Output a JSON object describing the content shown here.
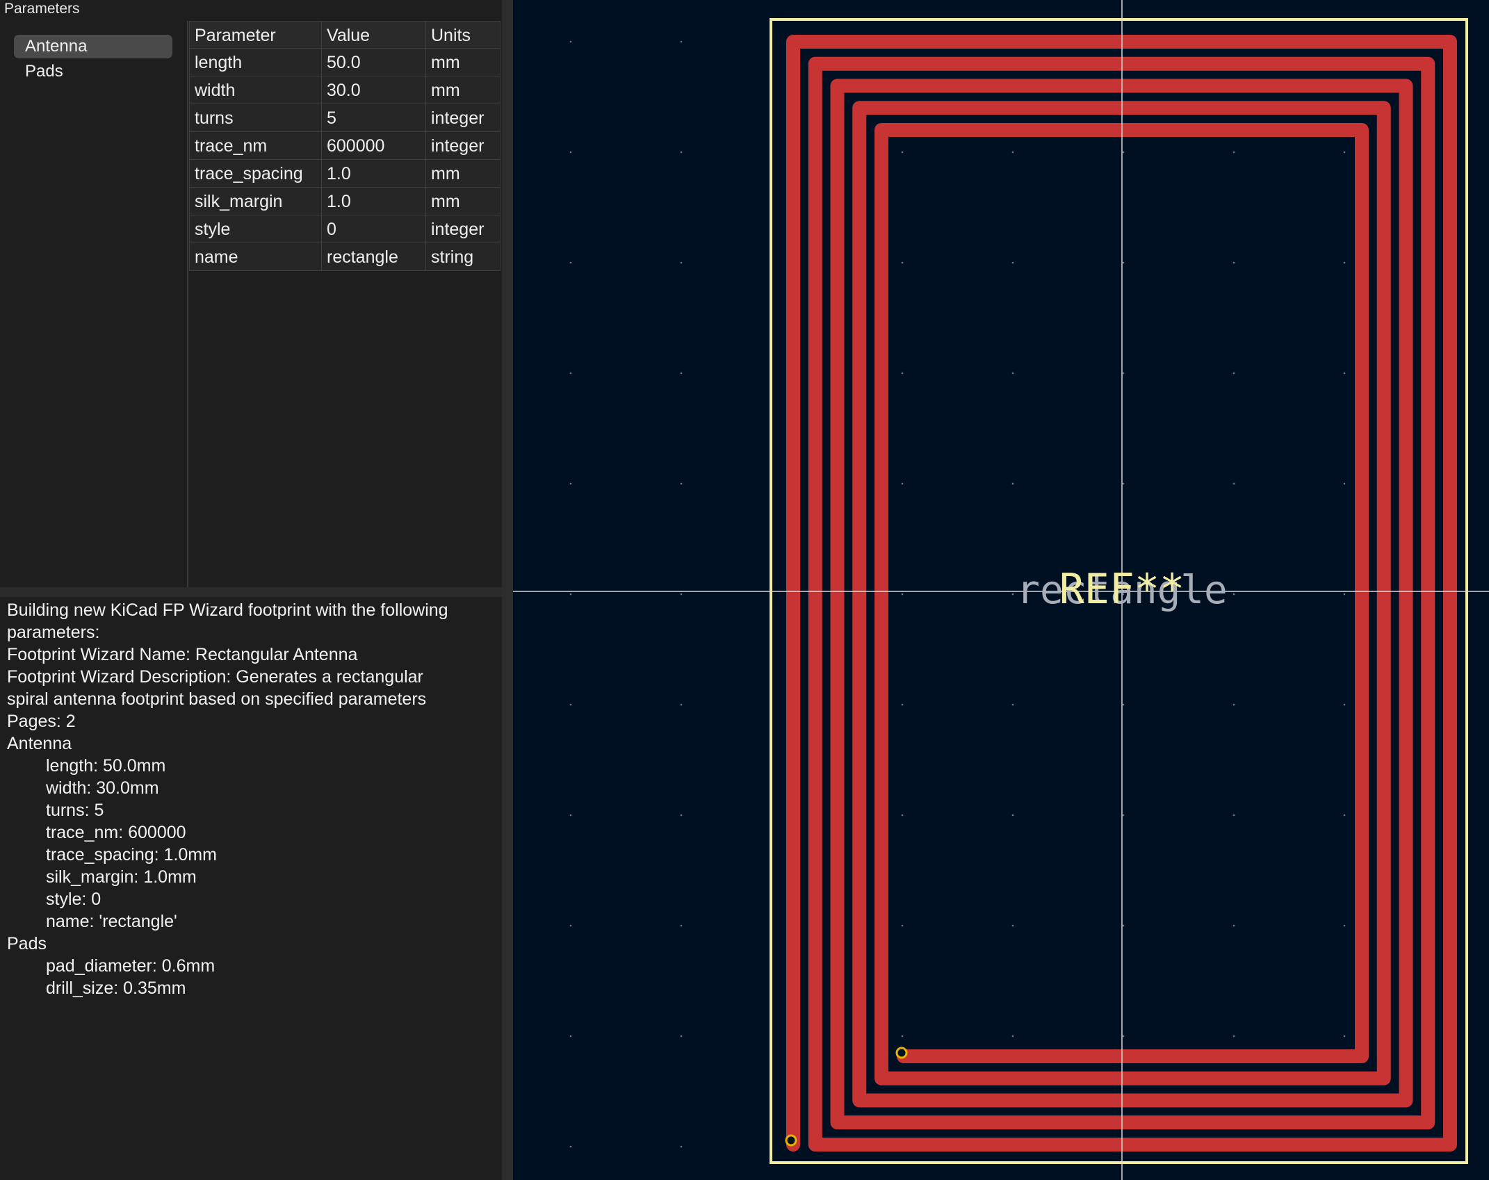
{
  "panel": {
    "title": "Parameters"
  },
  "pages": [
    {
      "label": "Antenna",
      "selected": true
    },
    {
      "label": "Pads",
      "selected": false
    }
  ],
  "param_table": {
    "headers": [
      "Parameter",
      "Value",
      "Units"
    ],
    "rows": [
      [
        "length",
        "50.0",
        "mm"
      ],
      [
        "width",
        "30.0",
        "mm"
      ],
      [
        "turns",
        "5",
        "integer"
      ],
      [
        "trace_nm",
        "600000",
        "integer"
      ],
      [
        "trace_spacing",
        "1.0",
        "mm"
      ],
      [
        "silk_margin",
        "1.0",
        "mm"
      ],
      [
        "style",
        "0",
        "integer"
      ],
      [
        "name",
        "rectangle",
        "string"
      ]
    ]
  },
  "log": {
    "lines": [
      {
        "text": "Building new KiCad FP Wizard footprint with the following",
        "indent": false
      },
      {
        "text": "parameters:",
        "indent": false
      },
      {
        "text": "Footprint Wizard Name:        Rectangular Antenna",
        "indent": false
      },
      {
        "text": "Footprint Wizard Description: Generates a rectangular",
        "indent": false
      },
      {
        "text": "spiral antenna footprint based on specified parameters",
        "indent": false
      },
      {
        "text": "Pages: 2",
        "indent": false
      },
      {
        "text": "Antenna",
        "indent": false
      },
      {
        "text": "length: 50.0mm",
        "indent": true
      },
      {
        "text": "width: 30.0mm",
        "indent": true
      },
      {
        "text": "turns: 5",
        "indent": true
      },
      {
        "text": "trace_nm: 600000",
        "indent": true
      },
      {
        "text": "trace_spacing: 1.0mm",
        "indent": true
      },
      {
        "text": "silk_margin: 1.0mm",
        "indent": true
      },
      {
        "text": "style: 0",
        "indent": true
      },
      {
        "text": "name: 'rectangle'",
        "indent": true
      },
      {
        "text": "Pads",
        "indent": false
      },
      {
        "text": "pad_diameter: 0.6mm",
        "indent": true
      },
      {
        "text": "drill_size: 0.35mm",
        "indent": true
      }
    ]
  },
  "preview": {
    "reference_text": "REF**",
    "value_text": "rectangle",
    "turns": 5,
    "colors": {
      "background": "#001023",
      "trace": "#c83434",
      "silkscreen": "#f2eda1",
      "value_text": "#a8aeb8",
      "pad": "#e8b400",
      "crosshair": "#d8d8d8",
      "grid_dot": "#6e7888"
    }
  }
}
